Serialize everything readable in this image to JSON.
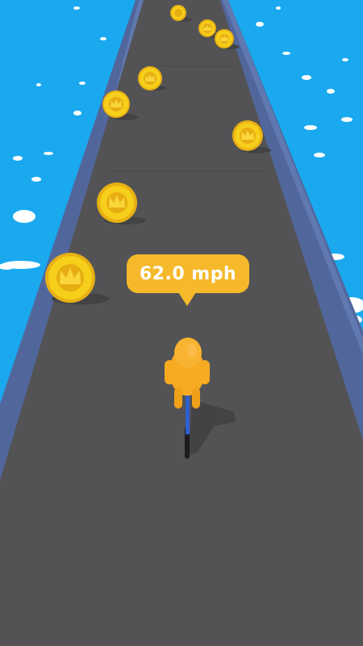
{
  "hud": {
    "speed_readout": "62.0 mph"
  },
  "scene": {
    "sky_water_color": "#1aa9ef",
    "road_color": "#535355",
    "rail_color": "#51679c",
    "coin_color": "#f6cf1a",
    "rider_color": "#f6ab22",
    "bike_color": "#2d5fd0"
  },
  "icons": {
    "coin_emblem": "crown-icon"
  }
}
